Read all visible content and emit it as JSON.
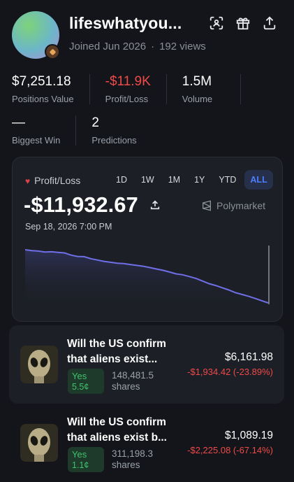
{
  "profile": {
    "username": "lifeswhatyou...",
    "joined": "Joined Jun 2026",
    "views": "192 views",
    "separator": "·"
  },
  "header_icons": [
    "scan-icon",
    "gift-icon",
    "share-icon"
  ],
  "stats_row1": [
    {
      "value": "$7,251.18",
      "label": "Positions Value",
      "negative": false
    },
    {
      "value": "-$11.9K",
      "label": "Profit/Loss",
      "negative": true
    },
    {
      "value": "1.5M",
      "label": "Volume",
      "negative": false
    }
  ],
  "stats_row2": [
    {
      "value": "—",
      "label": "Biggest Win"
    },
    {
      "value": "2",
      "label": "Predictions"
    }
  ],
  "pnl": {
    "label": "Profit/Loss",
    "ranges": [
      "1D",
      "1W",
      "1M",
      "1Y",
      "YTD",
      "ALL"
    ],
    "active_range": "ALL",
    "value": "-$11,932.67",
    "brand": "Polymarket",
    "date": "Sep 18, 2026 7:00 PM"
  },
  "chart_data": {
    "type": "area",
    "y": [
      0,
      -20,
      -30,
      -50,
      -45,
      -60,
      -70,
      -120,
      -150,
      -155,
      -200,
      -230,
      -260,
      -280,
      -300,
      -310,
      -330,
      -350,
      -370,
      -400,
      -430,
      -460,
      -500,
      -540,
      -560,
      -600,
      -640,
      -700,
      -760,
      -800,
      -850,
      -900,
      -960,
      -1000,
      -1040,
      -1090,
      -1140,
      -1190
    ],
    "xlabel": "",
    "ylabel": "",
    "grid": false,
    "line_color": "#6f6fe8"
  },
  "positions": [
    {
      "question": "Will the US confirm that aliens exist...",
      "outcome": "Yes",
      "price": "5.5¢",
      "shares_count": "148,481.5",
      "shares_label": "shares",
      "value": "$6,161.98",
      "change": "-$1,934.42 (-23.89%)"
    },
    {
      "question": "Will the US confirm that aliens exist b...",
      "outcome": "Yes",
      "price": "1.1¢",
      "shares_count": "311,198.3",
      "shares_label": "shares",
      "value": "$1,089.19",
      "change": "-$2,225.08 (-67.14%)"
    }
  ]
}
